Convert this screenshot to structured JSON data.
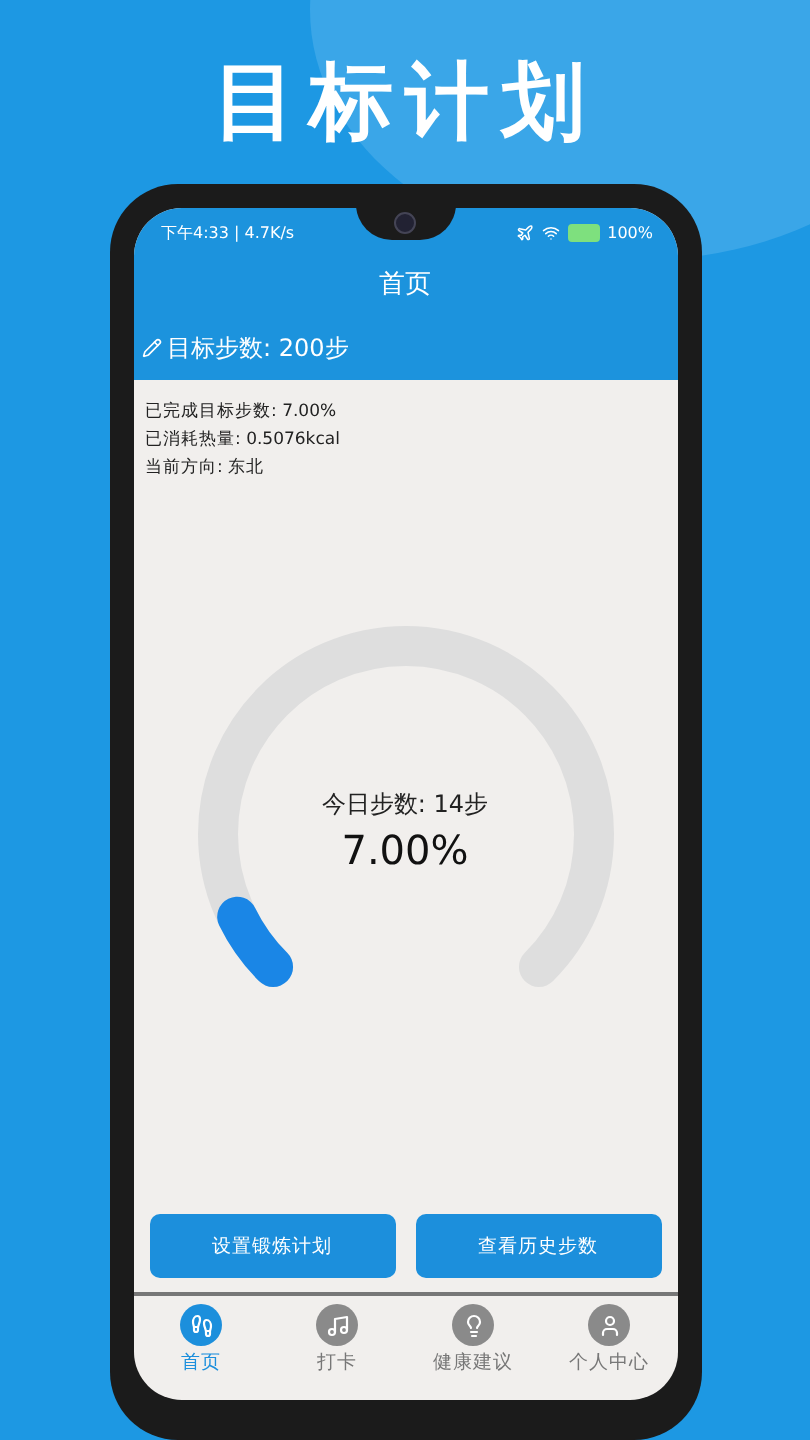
{
  "headline": "目标计划",
  "status_bar": {
    "time": "下午4:33 | 4.7K/s",
    "battery": "100%"
  },
  "app_bar": {
    "title": "首页"
  },
  "goal": {
    "text": "目标步数: 200步"
  },
  "stats": [
    "已完成目标步数: 7.00%",
    "已消耗热量: 0.5076kcal",
    "当前方向: 东北"
  ],
  "gauge": {
    "label": "今日步数: 14步",
    "percent": "7.00%",
    "level": 0.07
  },
  "buttons": [
    "设置锻炼计划",
    "查看历史步数"
  ],
  "nav": [
    {
      "label": "首页",
      "kind": "steps",
      "selected": true
    },
    {
      "label": "打卡",
      "kind": "note",
      "selected": false
    },
    {
      "label": "健康建议",
      "kind": "bulb",
      "selected": false
    },
    {
      "label": "个人中心",
      "kind": "person",
      "selected": false
    }
  ]
}
